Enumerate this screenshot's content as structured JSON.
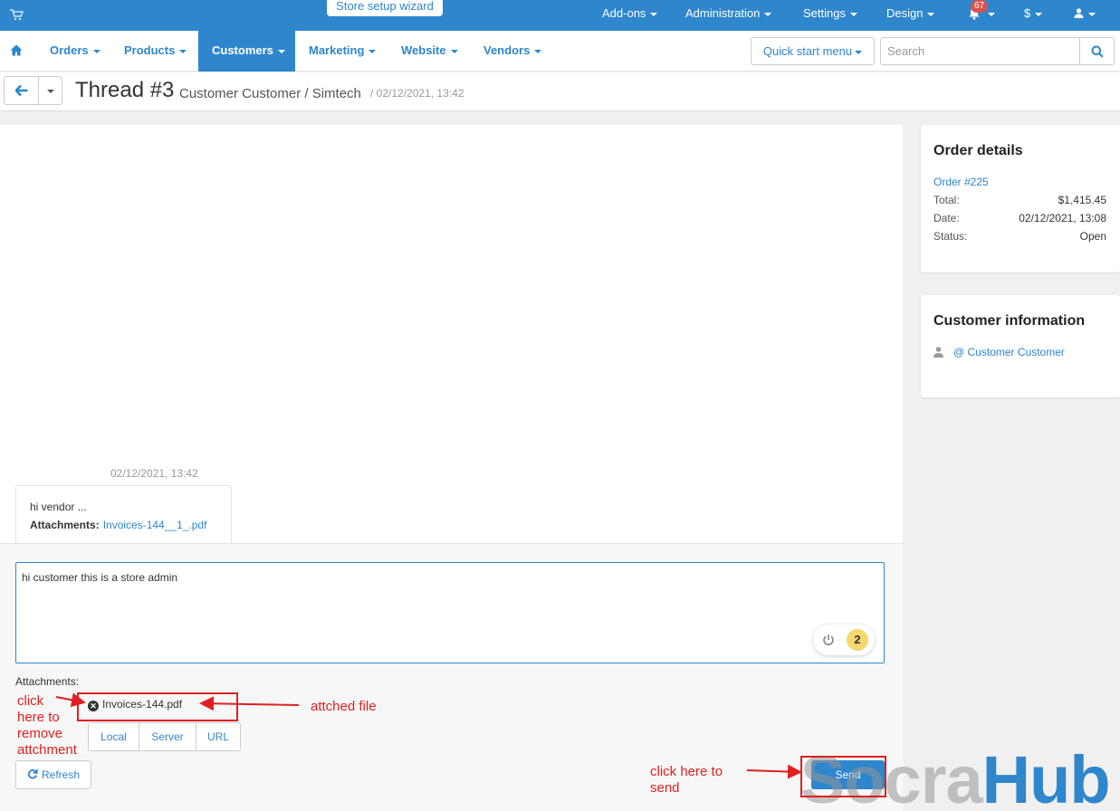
{
  "topbar": {
    "wizard_label": "Store setup wizard",
    "addons": "Add-ons",
    "administration": "Administration",
    "settings": "Settings",
    "design": "Design",
    "notifications_count": "67",
    "currency": "$"
  },
  "nav": {
    "orders": "Orders",
    "products": "Products",
    "customers": "Customers",
    "marketing": "Marketing",
    "website": "Website",
    "vendors": "Vendors",
    "quick_start": "Quick start menu",
    "search_placeholder": "Search"
  },
  "header": {
    "title": "Thread #3",
    "subtitle": "Customer Customer / Simtech",
    "date": "/ 02/12/2021, 13:42"
  },
  "thread": {
    "message_date": "02/12/2021, 13:42",
    "message_text": "hi vendor ...",
    "attachments_label": "Attachments:",
    "attachment_file": "Invoices-144__1_.pdf"
  },
  "compose": {
    "reply_text": "hi customer this is a store admin",
    "grammar_count": "2",
    "attachments_label": "Attachments:",
    "attached_file": "Invoices-144.pdf",
    "source_buttons": [
      "Local",
      "Server",
      "URL"
    ],
    "refresh_label": "Refresh",
    "send_label": "Send"
  },
  "order_details": {
    "heading": "Order details",
    "order_link": "Order #225",
    "total_label": "Total:",
    "total_value": "$1,415.45",
    "date_label": "Date:",
    "date_value": "02/12/2021, 13:08",
    "status_label": "Status:",
    "status_value": "Open"
  },
  "customer_info": {
    "heading": "Customer information",
    "customer_link": "@ Customer Customer"
  },
  "annotations": {
    "remove_note": [
      "click",
      "here to",
      "remove",
      "attchment"
    ],
    "attached_note": "attched file",
    "send_note": [
      "click here to",
      "send"
    ],
    "color": "#e02020"
  },
  "watermark": {
    "part1": "Socra",
    "part2": "Hub"
  },
  "colors": {
    "primary": "#2e86cd",
    "badge": "#d9534f"
  }
}
